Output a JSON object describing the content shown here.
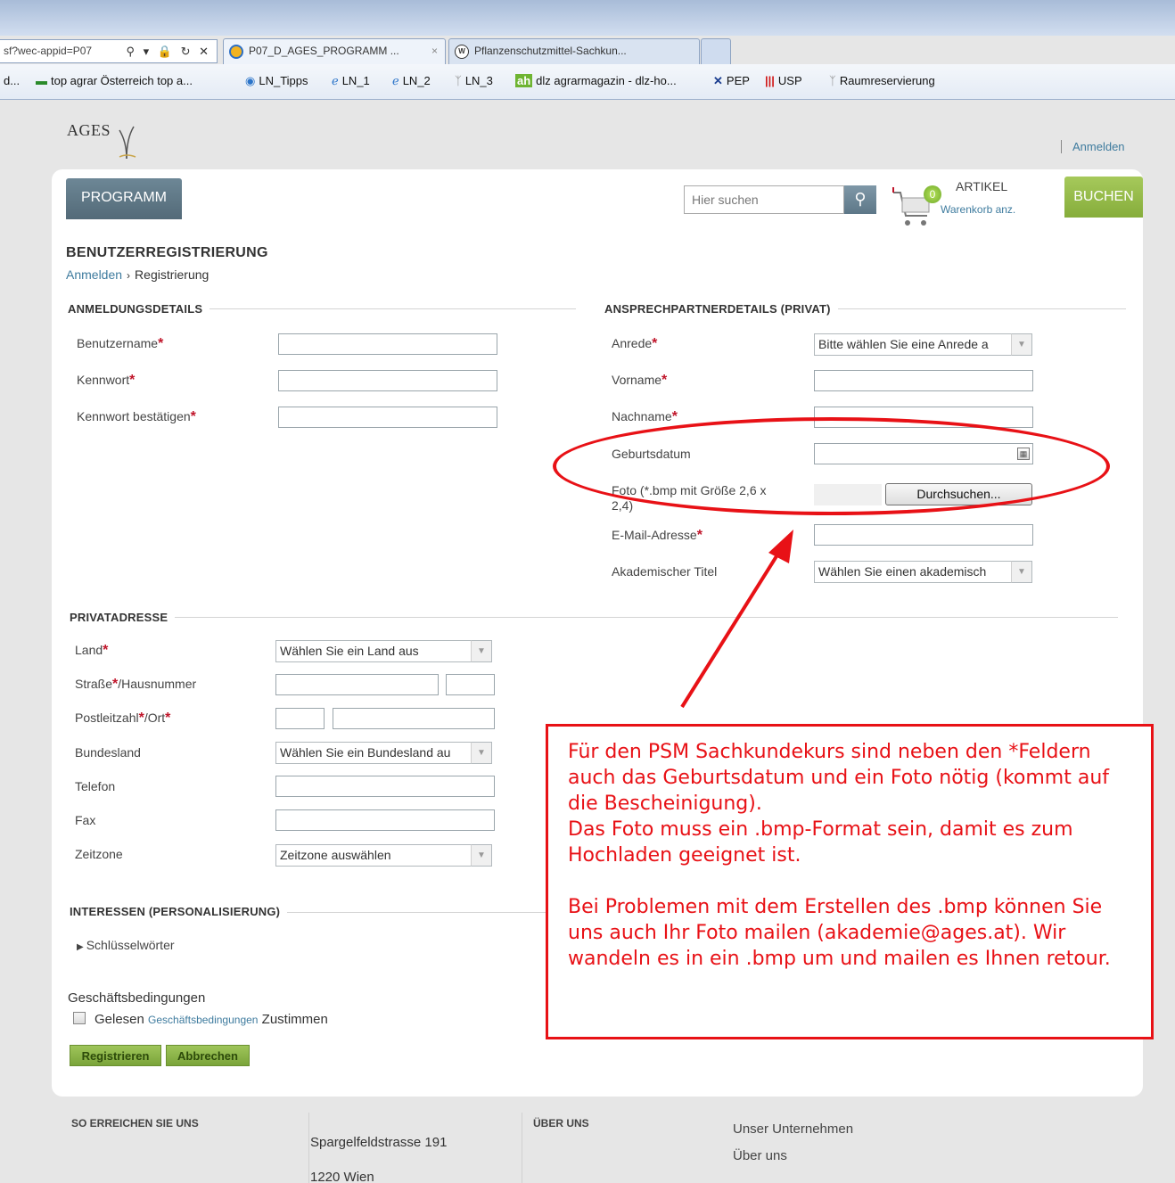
{
  "browser": {
    "address_text": "sf?wec-appid=P07",
    "address_icons": "⚲ ▾ 🔒 ↻ ✕",
    "tabs": [
      {
        "title": "P07_D_AGES_PROGRAMM ...",
        "close": "×"
      },
      {
        "title": "Pflanzenschutzmittel-Sachkun..."
      }
    ],
    "favorites": [
      {
        "label": "d...",
        "icon": ""
      },
      {
        "label": "top agrar Österreich top a...",
        "icon": "▬"
      },
      {
        "label": "LN_Tipps",
        "icon": "◉"
      },
      {
        "label": "LN_1",
        "icon": "ℯ"
      },
      {
        "label": "LN_2",
        "icon": "ℯ"
      },
      {
        "label": "LN_3",
        "icon": "ᛉ"
      },
      {
        "label": "dlz agrarmagazin - dlz-ho...",
        "icon": "ah"
      },
      {
        "label": "PEP",
        "icon": "✕"
      },
      {
        "label": "USP",
        "icon": "|||"
      },
      {
        "label": "Raumreservierung",
        "icon": "ᛉ"
      }
    ]
  },
  "header": {
    "logo_text": "AGES",
    "login_link": "Anmelden",
    "nav_programm": "PROGRAMM",
    "search_placeholder": "Hier suchen",
    "cart_count": "0",
    "cart_label": "ARTIKEL",
    "cart_link": "Warenkorb anz.",
    "buchen": "BUCHEN"
  },
  "page": {
    "title": "BENUTZERREGISTRIERUNG",
    "breadcrumb": {
      "link": "Anmelden",
      "separator": "›",
      "current": "Registrierung"
    }
  },
  "login_details": {
    "heading": "ANMELDUNGSDETAILS",
    "fields": [
      {
        "label": "Benutzername",
        "required": "*"
      },
      {
        "label": "Kennwort",
        "required": "*"
      },
      {
        "label": "Kennwort bestätigen",
        "required": "*"
      }
    ]
  },
  "contact_details": {
    "heading": "ANSPRECHPARTNERDETAILS (PRIVAT)",
    "anrede": {
      "label": "Anrede",
      "required": "*",
      "value": "Bitte wählen Sie eine Anrede a"
    },
    "vorname": {
      "label": "Vorname",
      "required": "*"
    },
    "nachname": {
      "label": "Nachname",
      "required": "*"
    },
    "geburtsdatum": {
      "label": "Geburtsdatum"
    },
    "foto": {
      "label_line1": "Foto (*.bmp mit Größe 2,6 x",
      "label_line2": "2,4)",
      "browse_button": "Durchsuchen..."
    },
    "email": {
      "label": "E-Mail-Adresse",
      "required": "*"
    },
    "title": {
      "label": "Akademischer Titel",
      "value": "Wählen Sie einen akademisch"
    }
  },
  "private_address": {
    "heading": "PRIVATADRESSE",
    "land": {
      "label": "Land",
      "required": "*",
      "value": "Wählen Sie ein Land aus"
    },
    "strasse": {
      "label_a": "Straße",
      "required": "*",
      "label_b": "/Hausnummer"
    },
    "plz": {
      "label_a": "Postleitzahl",
      "required_a": "*",
      "label_b": "/Ort",
      "required_b": "*"
    },
    "bundesland": {
      "label": "Bundesland",
      "value": "Wählen Sie ein Bundesland au"
    },
    "telefon": {
      "label": "Telefon"
    },
    "fax": {
      "label": "Fax"
    },
    "zeitzone": {
      "label": "Zeitzone",
      "value": "Zeitzone auswählen"
    }
  },
  "interests": {
    "heading": "INTERESSEN (PERSONALISIERUNG)",
    "keywords": "Schlüsselwörter",
    "keywords_arrow": "▶"
  },
  "terms": {
    "title": "Geschäftsbedingungen",
    "read": "Gelesen",
    "link": "Geschäftsbedingungen",
    "agree": "Zustimmen"
  },
  "actions": {
    "register": "Registrieren",
    "cancel": "Abbrechen"
  },
  "annotation": {
    "para1": "Für den PSM Sachkundekurs sind neben den *Feldern auch das Geburtsdatum und ein Foto nötig (kommt auf die Bescheinigung).",
    "para2": "Das Foto muss ein .bmp-Format sein, damit es zum Hochladen geeignet ist.",
    "para3": "Bei Problemen mit dem Erstellen des .bmp können Sie uns auch Ihr Foto mailen (akademie@ages.at). Wir wandeln es in ein .bmp um und mailen es Ihnen retour.",
    "color": "#e81116"
  },
  "footer": {
    "contact_heading": "SO ERREICHEN SIE UNS",
    "street": "Spargelfeldstrasse 191",
    "city": "1220 Wien",
    "about_heading": "ÜBER UNS",
    "links": [
      "Unser Unternehmen",
      "Über uns"
    ]
  },
  "colors": {
    "accent_green": "#8ab243",
    "nav_slate": "#5f7889",
    "link_blue": "#3e7b9e",
    "required_red": "#c0152a"
  }
}
